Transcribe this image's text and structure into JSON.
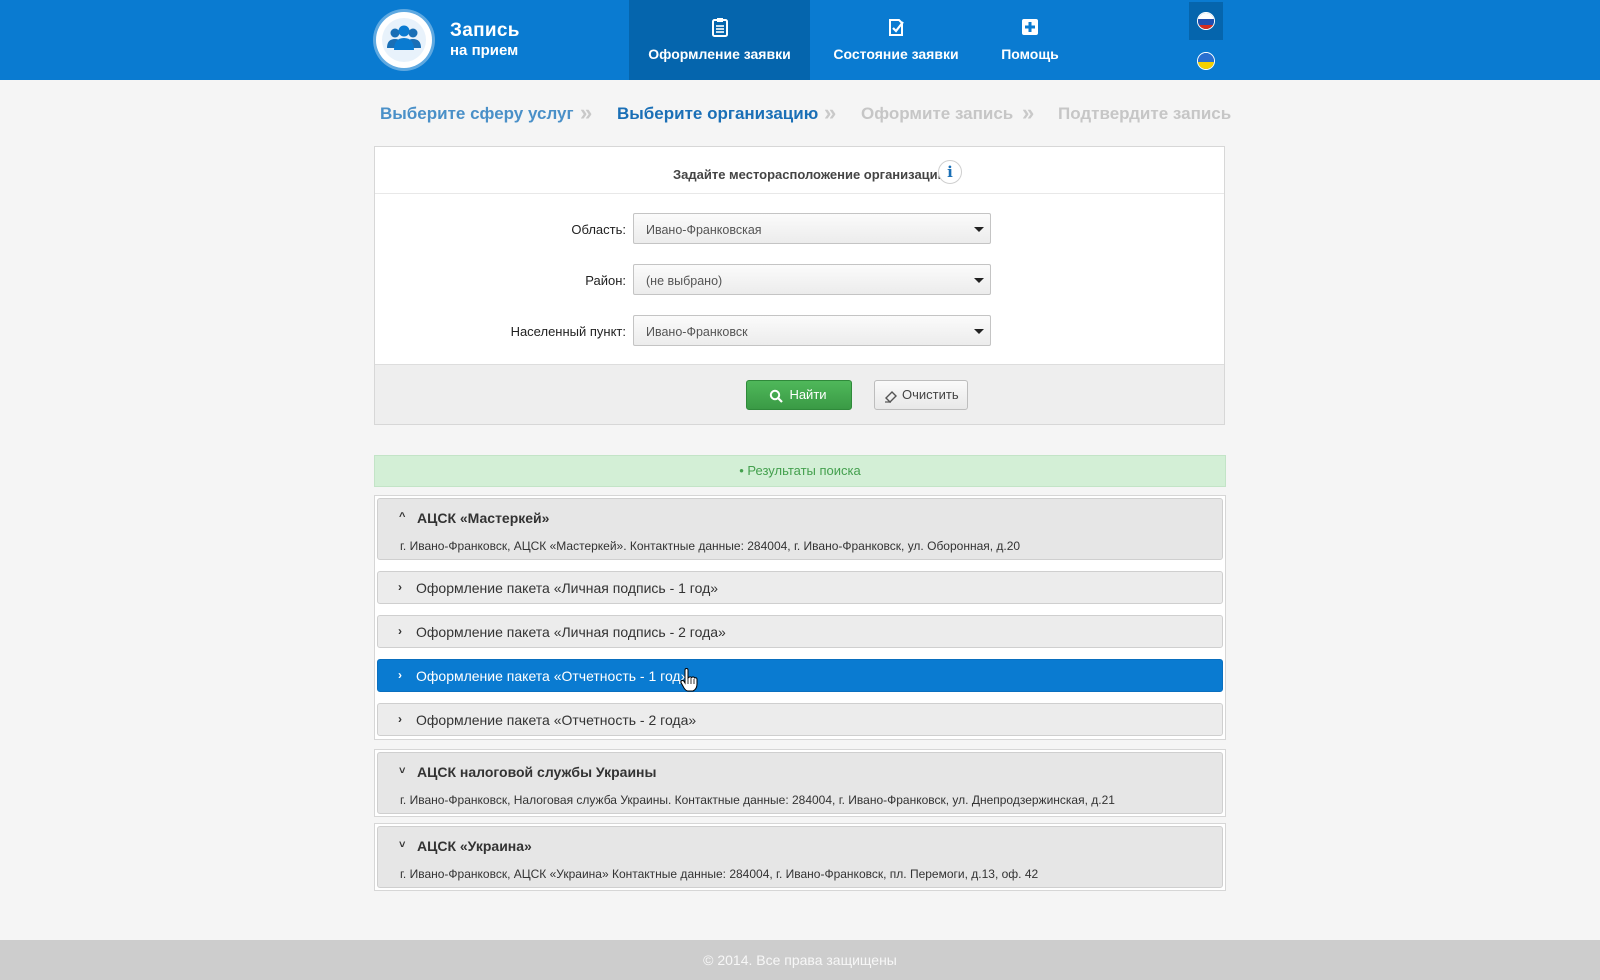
{
  "brand": {
    "line1": "Запись",
    "line2": "на прием"
  },
  "nav": [
    {
      "label": "Оформление заявки",
      "icon": "clipboard-icon",
      "active": true
    },
    {
      "label": "Состояние заявки",
      "icon": "check-doc-icon"
    },
    {
      "label": "Помощь",
      "icon": "plus-box-icon"
    }
  ],
  "languages": [
    "ru",
    "ua"
  ],
  "steps": [
    {
      "label": "Выберите сферу услуг",
      "state": "done"
    },
    {
      "label": "Выберите организацию",
      "state": "current"
    },
    {
      "label": "Оформите запись",
      "state": "todo"
    },
    {
      "label": "Подтвердите запись",
      "state": "todo"
    }
  ],
  "location": {
    "title": "Задайте месторасположение организации",
    "fields": [
      {
        "label": "Область:",
        "value": "Ивано-Франковская"
      },
      {
        "label": "Район:",
        "value": "(не выбрано)"
      },
      {
        "label": "Населенный пункт:",
        "value": "Ивано-Франковск"
      }
    ],
    "find_label": "Найти",
    "clear_label": "Очистить"
  },
  "results": {
    "title": "• Результаты поиска",
    "orgs": [
      {
        "name": "АЦСК «Мастеркей»",
        "desc": "г. Ивано-Франковск, АЦСК «Мастеркей». Контактные данные: 284004, г. Ивано-Франковск, ул. Оборонная, д.20",
        "expanded": true,
        "packages": [
          "Оформление пакета «Личная подпись - 1 год»",
          "Оформление пакета «Личная подпись - 2 года»",
          "Оформление пакета «Отчетность - 1 год»",
          "Оформление пакета «Отчетность - 2 года»"
        ],
        "active_package": 2
      },
      {
        "name": "АЦСК налоговой службы Украины",
        "desc": "г. Ивано-Франковск, Налоговая служба Украины. Контактные данные: 284004, г. Ивано-Франковск, ул. Днепродзержинская, д.21",
        "expanded": false
      },
      {
        "name": "АЦСК «Украина»",
        "desc": "г. Ивано-Франковск, АЦСК «Украина» Контактные данные: 284004, г. Ивано-Франковск, пл. Перемоги, д.13, оф. 42",
        "expanded": false
      }
    ]
  },
  "footer": "© 2014. Все права защищены",
  "colors": {
    "header": "#0a7bd1",
    "header_active": "#0565ad",
    "success": "#3a9a45",
    "results_bg": "#d3efd6"
  }
}
